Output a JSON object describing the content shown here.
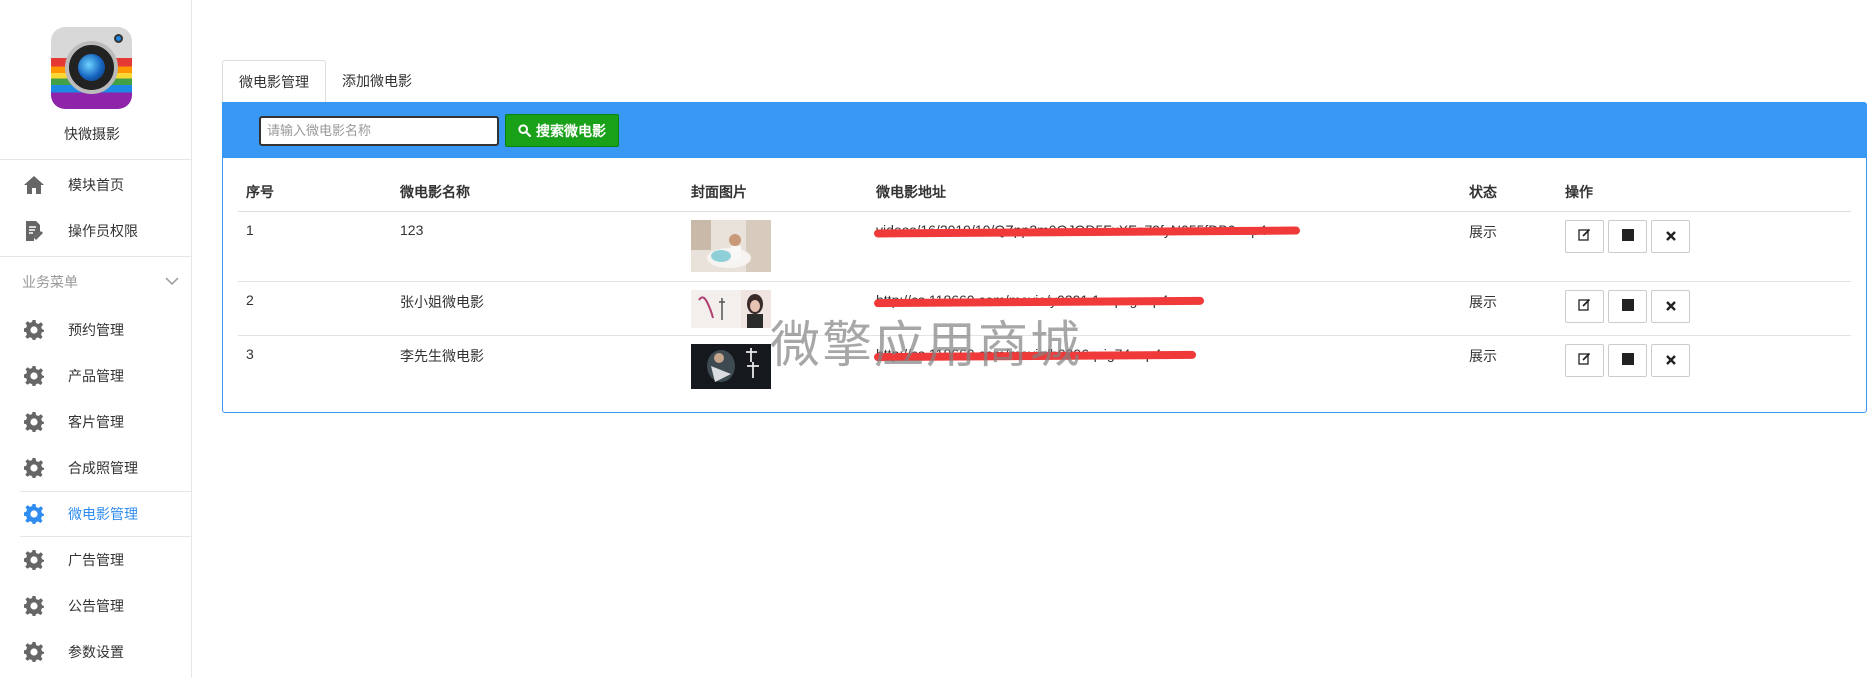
{
  "app": {
    "name": "快微摄影"
  },
  "sidebar": {
    "top_items": [
      {
        "label": "模块首页",
        "icon": "home-icon"
      },
      {
        "label": "操作员权限",
        "icon": "document-edit-icon"
      }
    ],
    "group_label": "业务菜单",
    "group_items": [
      {
        "label": "预约管理",
        "icon": "gear-icon"
      },
      {
        "label": "产品管理",
        "icon": "gear-icon"
      },
      {
        "label": "客片管理",
        "icon": "gear-icon"
      },
      {
        "label": "合成照管理",
        "icon": "gear-icon"
      },
      {
        "label": "微电影管理",
        "icon": "gear-icon",
        "active": true
      },
      {
        "label": "广告管理",
        "icon": "gear-icon"
      },
      {
        "label": "公告管理",
        "icon": "gear-icon"
      },
      {
        "label": "参数设置",
        "icon": "gear-icon"
      }
    ]
  },
  "tabs": [
    {
      "label": "微电影管理",
      "active": true
    },
    {
      "label": "添加微电影",
      "active": false
    }
  ],
  "search": {
    "placeholder": "请输入微电影名称",
    "value": "",
    "button_label": "搜索微电影"
  },
  "table": {
    "headers": [
      "序号",
      "微电影名称",
      "封面图片",
      "微电影地址",
      "状态",
      "操作"
    ],
    "rows": [
      {
        "index": "1",
        "name": "123",
        "url": "videos/16/2019/10/QZpp2m0OJOD5FxXFo79fyN055fDB0.mp4",
        "status": "展示"
      },
      {
        "index": "2",
        "name": "张小姐微电影",
        "url": "http://cs.118660.com/movie/y0391 1cepsg.mp4",
        "status": "展示"
      },
      {
        "index": "3",
        "name": "李先生微电影",
        "url": "http://cs.118660.com/movie/b0396qcig74.mp4",
        "status": "展示"
      }
    ]
  },
  "watermark": "微擎应用商城",
  "colors": {
    "accent": "#3a98f5",
    "search_button": "#1aa11a",
    "active_nav": "#2f8cf0",
    "redaction": "#f03a3a"
  }
}
